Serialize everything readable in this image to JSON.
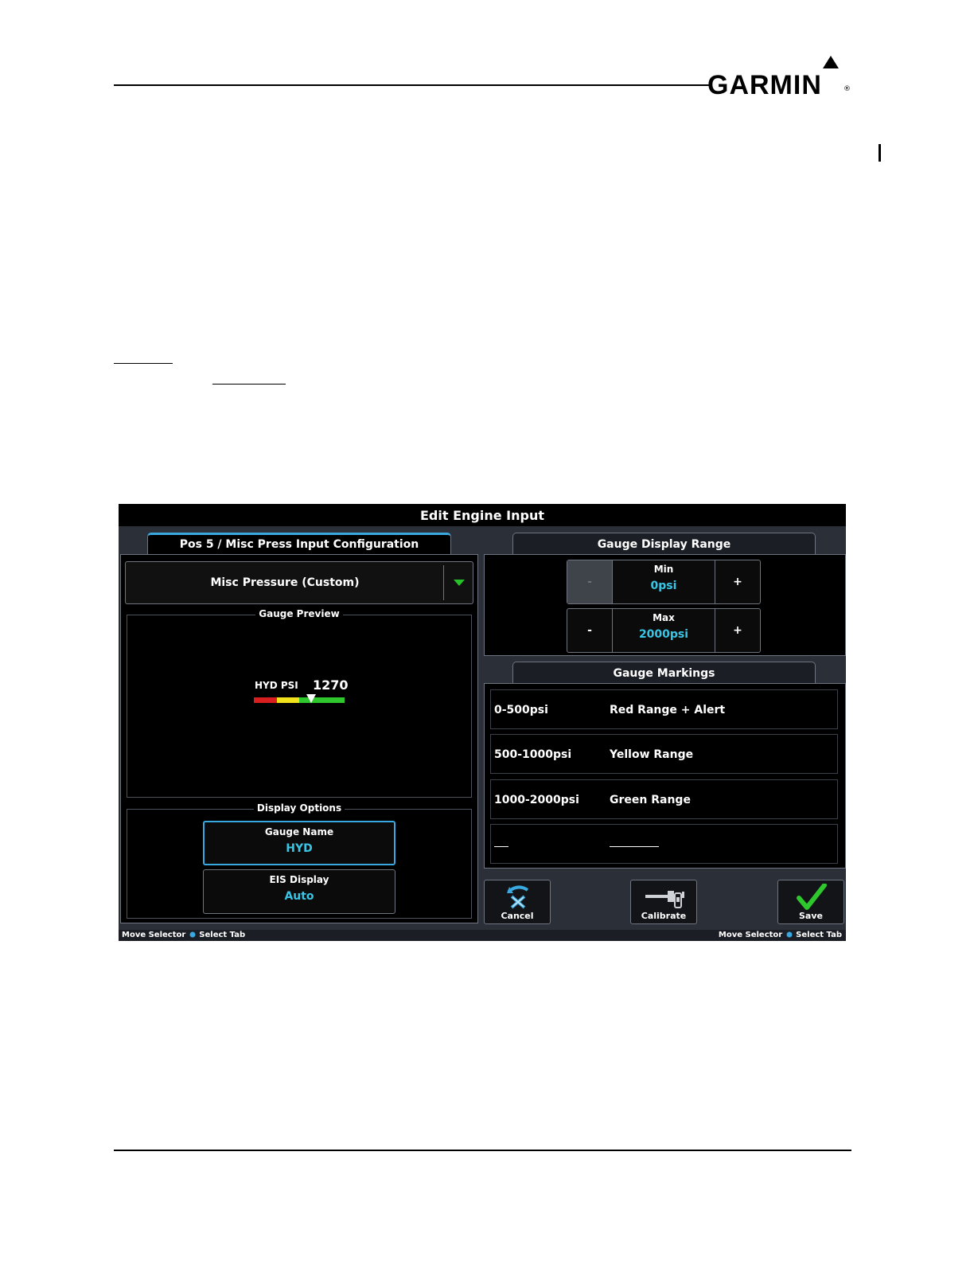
{
  "document": {
    "brand": "GARMIN",
    "registered_mark": "®"
  },
  "screen": {
    "title": "Edit Engine Input",
    "left_tab": "Pos 5 / Misc Press Input Configuration",
    "right_tab_range": "Gauge Display Range",
    "right_tab_markings": "Gauge Markings",
    "input_type": "Misc Pressure (Custom)",
    "gauge_preview": {
      "title": "Gauge Preview",
      "name": "HYD PSI",
      "value": "1270",
      "pointer_value_psi": 1270,
      "range_min_psi": 0,
      "range_max_psi": 2000,
      "colors": {
        "red": "#d81e1e",
        "yellow": "#f2e21c",
        "green": "#2ec72e"
      }
    },
    "display_options": {
      "title": "Display Options",
      "gauge_name_label": "Gauge Name",
      "gauge_name_value": "HYD",
      "eis_display_label": "EIS Display",
      "eis_display_value": "Auto"
    },
    "range": {
      "min_label": "Min",
      "min_value": "0psi",
      "max_label": "Max",
      "max_value": "2000psi",
      "minus": "-",
      "plus": "+"
    },
    "markings": [
      {
        "range": "0-500psi",
        "color": "Red Range + Alert"
      },
      {
        "range": "500-1000psi",
        "color": "Yellow Range"
      },
      {
        "range": "1000-2000psi",
        "color": "Green Range"
      }
    ],
    "buttons": {
      "cancel": "Cancel",
      "calibrate": "Calibrate",
      "save": "Save"
    },
    "status_left": {
      "move": "Move Selector",
      "select": "Select Tab"
    },
    "status_right": {
      "move": "Move Selector",
      "select": "Select Tab"
    },
    "accent_color": "#39c6e6",
    "selection_color": "#3aa8e0"
  }
}
